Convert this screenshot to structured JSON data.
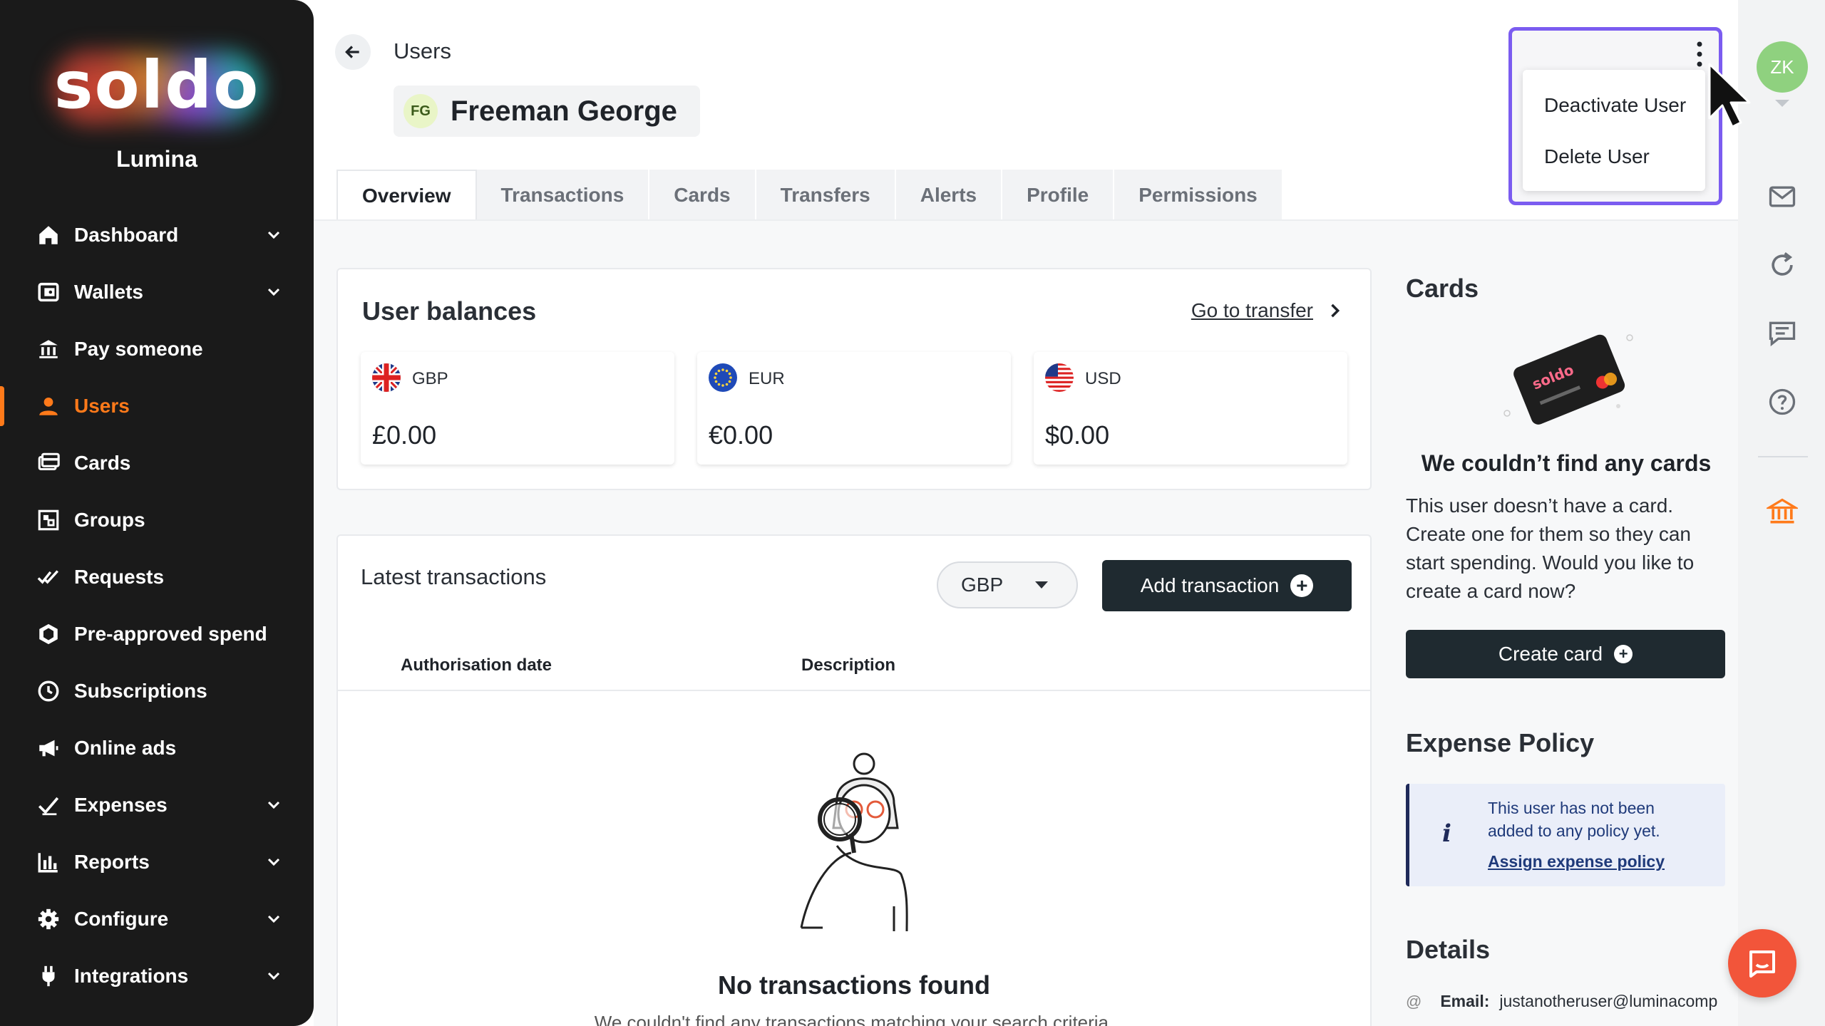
{
  "brand": {
    "logo_text": "soldo",
    "org_name": "Lumina"
  },
  "nav": [
    {
      "label": "Dashboard",
      "icon": "home-icon",
      "chevron": true
    },
    {
      "label": "Wallets",
      "icon": "wallet-icon",
      "chevron": true
    },
    {
      "label": "Pay someone",
      "icon": "bank-transfer-icon",
      "chevron": false
    },
    {
      "label": "Users",
      "icon": "user-icon",
      "chevron": false,
      "active": true
    },
    {
      "label": "Cards",
      "icon": "card-icon",
      "chevron": false
    },
    {
      "label": "Groups",
      "icon": "groups-icon",
      "chevron": false
    },
    {
      "label": "Requests",
      "icon": "double-check-icon",
      "chevron": false
    },
    {
      "label": "Pre-approved spend",
      "icon": "shield-icon",
      "chevron": false
    },
    {
      "label": "Subscriptions",
      "icon": "clock-icon",
      "chevron": false
    },
    {
      "label": "Online ads",
      "icon": "megaphone-icon",
      "chevron": false
    },
    {
      "label": "Expenses",
      "icon": "check-icon",
      "chevron": true
    },
    {
      "label": "Reports",
      "icon": "bar-chart-icon",
      "chevron": true
    },
    {
      "label": "Configure",
      "icon": "gear-icon",
      "chevron": true
    },
    {
      "label": "Integrations",
      "icon": "plug-icon",
      "chevron": true
    }
  ],
  "header": {
    "breadcrumb": "Users",
    "user_initials": "FG",
    "user_name": "Freeman George"
  },
  "tabs": [
    "Overview",
    "Transactions",
    "Cards",
    "Transfers",
    "Alerts",
    "Profile",
    "Permissions"
  ],
  "active_tab": "Overview",
  "balances": {
    "title": "User balances",
    "go_transfer": "Go to transfer",
    "items": [
      {
        "currency": "GBP",
        "amount": "£0.00"
      },
      {
        "currency": "EUR",
        "amount": "€0.00"
      },
      {
        "currency": "USD",
        "amount": "$0.00"
      }
    ]
  },
  "latest": {
    "title": "Latest transactions",
    "currency_select": "GBP",
    "add_button": "Add transaction",
    "columns": [
      "Authorisation date",
      "Description"
    ],
    "empty_title": "No transactions found",
    "empty_sub": "We couldn't find any transactions matching your search criteria."
  },
  "cards_panel": {
    "title": "Cards",
    "empty_title": "We couldn’t find any cards",
    "empty_text": "This user doesn’t have a card. Create one for them so they can start spending. Would you like to create a card now?",
    "create_button": "Create card"
  },
  "expense_policy": {
    "title": "Expense Policy",
    "message": "This user has not been added to any policy yet.",
    "link": "Assign expense policy"
  },
  "details": {
    "title": "Details",
    "email_label": "Email:",
    "email_value": "justanotheruser@luminacomp"
  },
  "menu": {
    "items": [
      "Deactivate User",
      "Delete User"
    ]
  },
  "rail": {
    "avatar_initials": "ZK"
  },
  "colors": {
    "accent": "#ff7a1a",
    "sidebar_bg": "#1a1a1a",
    "highlight": "#7b5cf0",
    "button_dark": "#1f2a30",
    "chat": "#f2553a"
  }
}
